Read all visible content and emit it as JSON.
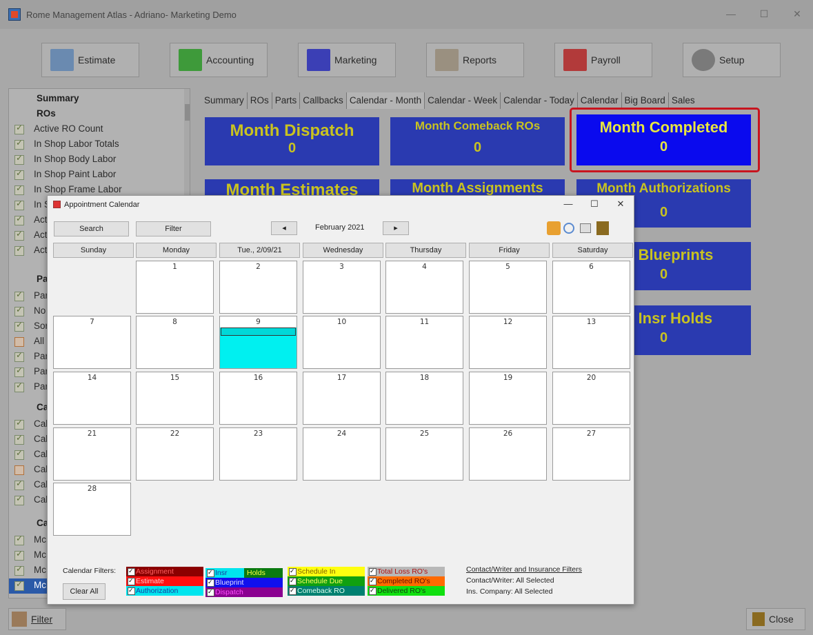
{
  "window": {
    "title": "Rome Management Atlas - Adriano- Marketing Demo"
  },
  "toolbar": [
    {
      "label": "Estimate",
      "icon": "estimate-icon",
      "color": "#6a8ab0"
    },
    {
      "label": "Accounting",
      "icon": "money-icon",
      "color": "#3e9a3a"
    },
    {
      "label": "Marketing",
      "icon": "building-icon",
      "color": "#3b3fb5"
    },
    {
      "label": "Reports",
      "icon": "reports-icon",
      "color": "#9a9080"
    },
    {
      "label": "Payroll",
      "icon": "payroll-icon",
      "color": "#b23a3a"
    },
    {
      "label": "Setup",
      "icon": "gears-icon",
      "color": "#7a7a7a"
    }
  ],
  "sidebar": {
    "headers": [
      "Summary",
      "ROs",
      "Par",
      "Cal",
      "Cal"
    ],
    "items": [
      {
        "label": "Active RO Count",
        "checked": true
      },
      {
        "label": "In Shop Labor Totals",
        "checked": true
      },
      {
        "label": "In Shop Body Labor",
        "checked": true
      },
      {
        "label": "In Shop Paint Labor",
        "checked": true
      },
      {
        "label": "In Shop Frame Labor",
        "checked": true
      },
      {
        "label": "In S",
        "checked": true
      },
      {
        "label": "Act",
        "checked": true
      },
      {
        "label": "Act",
        "checked": true
      },
      {
        "label": "Act",
        "checked": true
      },
      {
        "label": "Par",
        "checked": true
      },
      {
        "label": "No",
        "checked": true
      },
      {
        "label": "Sor",
        "checked": true
      },
      {
        "label": "All",
        "checked": false
      },
      {
        "label": "Par",
        "checked": true
      },
      {
        "label": "Par",
        "checked": true
      },
      {
        "label": "Par",
        "checked": true
      },
      {
        "label": "Cal",
        "checked": true
      },
      {
        "label": "Cal",
        "checked": true
      },
      {
        "label": "Cal",
        "checked": true
      },
      {
        "label": "Cal",
        "checked": false
      },
      {
        "label": "Cal",
        "checked": true
      },
      {
        "label": "Cal",
        "checked": true
      },
      {
        "label": "Mc",
        "checked": true
      },
      {
        "label": "Mc",
        "checked": true
      },
      {
        "label": "Mc",
        "checked": true
      },
      {
        "label": "Mc",
        "checked": true
      }
    ]
  },
  "tabs": [
    "Summary",
    "ROs",
    "Parts",
    "Callbacks",
    "Calendar - Month",
    "Calendar - Week",
    "Calendar - Today",
    "Calendar",
    "Big Board",
    "Sales"
  ],
  "active_tab": "Calendar - Month",
  "tiles": [
    {
      "title": "Month Dispatch",
      "value": "0"
    },
    {
      "title": "Month Comeback ROs",
      "value": "0"
    },
    {
      "title": "Month Completed",
      "value": "0"
    },
    {
      "title": "Month Estimates",
      "value": ""
    },
    {
      "title": "Month Assignments",
      "value": ""
    },
    {
      "title": "Month Authorizations",
      "value": "0"
    },
    {
      "title": "h Blueprints",
      "value": "0"
    },
    {
      "title": "h Insr Holds",
      "value": "0"
    }
  ],
  "calendar": {
    "title": "Appointment Calendar",
    "month_label": "February 2021",
    "search_label": "Search",
    "filter_label": "Filter",
    "prev": "◂",
    "next": "▸",
    "days": [
      "Sunday",
      "Monday",
      "Tue., 2/09/21",
      "Wednesday",
      "Thursday",
      "Friday",
      "Saturday"
    ],
    "dates": [
      "",
      "1",
      "2",
      "3",
      "4",
      "5",
      "6",
      "7",
      "8",
      "9",
      "10",
      "11",
      "12",
      "13",
      "14",
      "15",
      "16",
      "17",
      "18",
      "19",
      "20",
      "21",
      "22",
      "23",
      "24",
      "25",
      "26",
      "27",
      "28"
    ],
    "today": "9",
    "filters_label": "Calendar Filters:",
    "clear_all": "Clear All",
    "filters": [
      {
        "label": "Assignment",
        "bg": "#8b0000",
        "fg": "#ff6060"
      },
      {
        "label": "Estimate",
        "bg": "#ff1010",
        "fg": "#ffd0d0"
      },
      {
        "label": "Authorization",
        "bg": "#00e5ee",
        "fg": "#1a3aa0"
      },
      {
        "label": "Insr",
        "bg": "#00e5ee",
        "fg": "#1a3aa0"
      },
      {
        "label": "Holds",
        "bg": "#0a7a10",
        "fg": "#ffff40"
      },
      {
        "label": "Blueprint",
        "bg": "#1010ee",
        "fg": "#e0e0ff"
      },
      {
        "label": "Dispatch",
        "bg": "#8a0090",
        "fg": "#ff50ff"
      },
      {
        "label": "Schedule In",
        "bg": "#ffff10",
        "fg": "#806000"
      },
      {
        "label": "Schedule Due",
        "bg": "#10a010",
        "fg": "#ffff60"
      },
      {
        "label": "Comeback RO",
        "bg": "#008070",
        "fg": "#e0fff0"
      },
      {
        "label": "Total Loss RO's",
        "bg": "#b8b8b8",
        "fg": "#b01010"
      },
      {
        "label": "Completed RO's",
        "bg": "#ff6a00",
        "fg": "#601000"
      },
      {
        "label": "Delivered RO's",
        "bg": "#10e010",
        "fg": "#104010"
      }
    ],
    "contact_link": "Contact/Writer and Insurance Filters",
    "contact_writer": "Contact/Writer: All Selected",
    "ins_company": "Ins. Company:  All Selected"
  },
  "bottom": {
    "filter_label": "Filter",
    "close_label": "Close"
  }
}
